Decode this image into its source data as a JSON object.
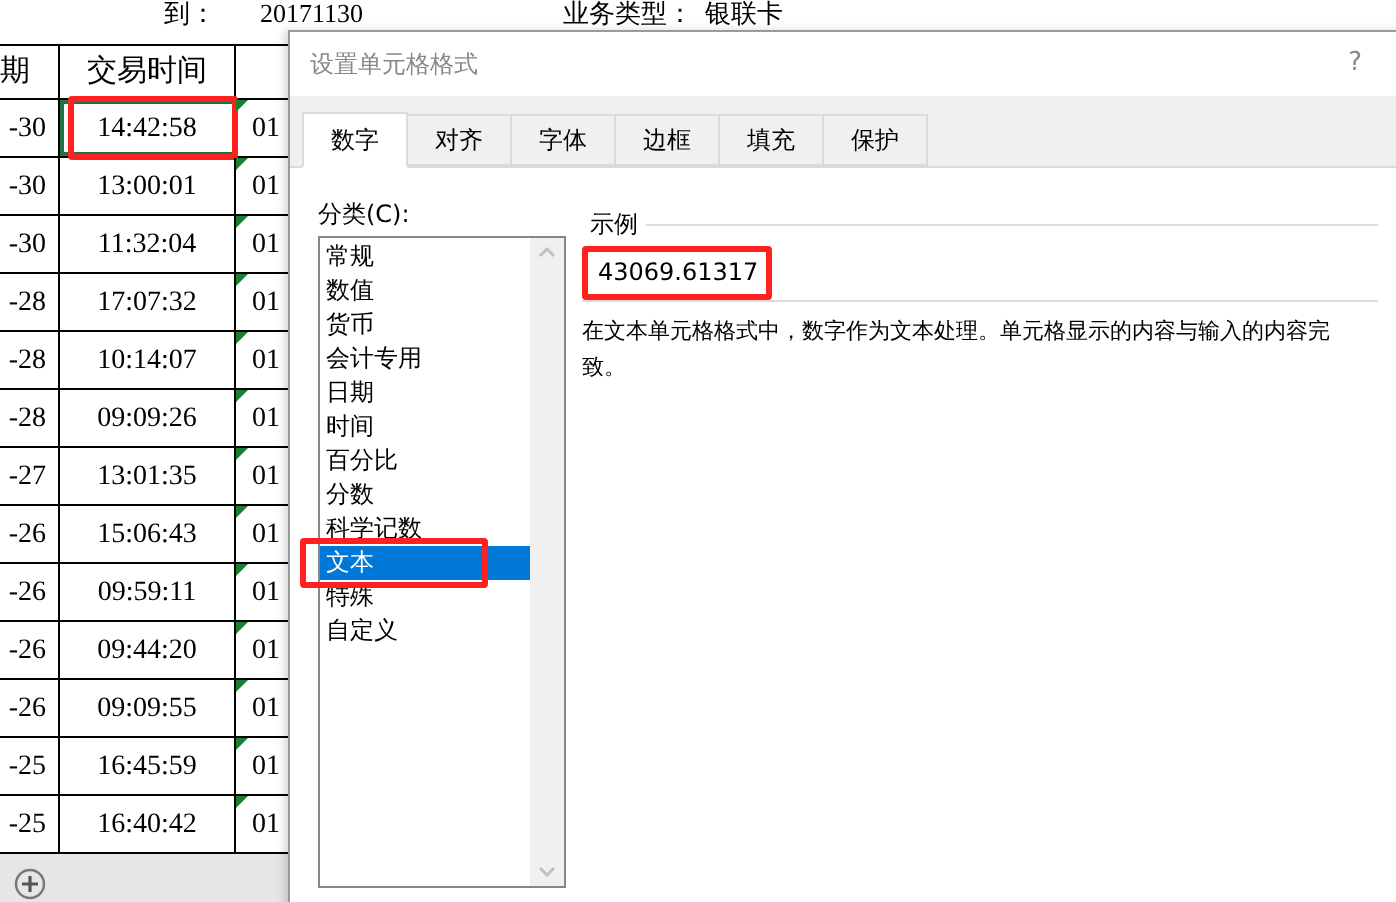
{
  "report_header": {
    "to_label": "到：",
    "to_value": "20171130",
    "type_label": "业务类型：",
    "type_value": "银联卡"
  },
  "table": {
    "columns": [
      "期",
      "交易时间"
    ],
    "rows": [
      {
        "cells": [
          "-30",
          "14:42:58",
          "01"
        ],
        "selected": true,
        "highlighted": true
      },
      {
        "cells": [
          "-30",
          "13:00:01",
          "01"
        ],
        "selected": false,
        "highlighted": false
      },
      {
        "cells": [
          "-30",
          "11:32:04",
          "01"
        ],
        "selected": false,
        "highlighted": false
      },
      {
        "cells": [
          "-28",
          "17:07:32",
          "01"
        ],
        "selected": false,
        "highlighted": false
      },
      {
        "cells": [
          "-28",
          "10:14:07",
          "01"
        ],
        "selected": false,
        "highlighted": false
      },
      {
        "cells": [
          "-28",
          "09:09:26",
          "01"
        ],
        "selected": false,
        "highlighted": false
      },
      {
        "cells": [
          "-27",
          "13:01:35",
          "01"
        ],
        "selected": false,
        "highlighted": false
      },
      {
        "cells": [
          "-26",
          "15:06:43",
          "01"
        ],
        "selected": false,
        "highlighted": false
      },
      {
        "cells": [
          "-26",
          "09:59:11",
          "01"
        ],
        "selected": false,
        "highlighted": false
      },
      {
        "cells": [
          "-26",
          "09:44:20",
          "01"
        ],
        "selected": false,
        "highlighted": false
      },
      {
        "cells": [
          "-26",
          "09:09:55",
          "01"
        ],
        "selected": false,
        "highlighted": false
      },
      {
        "cells": [
          "-25",
          "16:45:59",
          "01"
        ],
        "selected": false,
        "highlighted": false
      },
      {
        "cells": [
          "-25",
          "16:40:42",
          "01"
        ],
        "selected": false,
        "highlighted": false
      }
    ]
  },
  "dialog": {
    "title": "设置单元格格式",
    "help": "?",
    "tabs": [
      {
        "label": "数字",
        "selected": true
      },
      {
        "label": "对齐",
        "selected": false
      },
      {
        "label": "字体",
        "selected": false
      },
      {
        "label": "边框",
        "selected": false
      },
      {
        "label": "填充",
        "selected": false
      },
      {
        "label": "保护",
        "selected": false
      }
    ],
    "category_label": "分类(C):",
    "categories": [
      {
        "label": "常规",
        "selected": false,
        "highlighted": false
      },
      {
        "label": "数值",
        "selected": false,
        "highlighted": false
      },
      {
        "label": "货币",
        "selected": false,
        "highlighted": false
      },
      {
        "label": "会计专用",
        "selected": false,
        "highlighted": false
      },
      {
        "label": "日期",
        "selected": false,
        "highlighted": false
      },
      {
        "label": "时间",
        "selected": false,
        "highlighted": false
      },
      {
        "label": "百分比",
        "selected": false,
        "highlighted": false
      },
      {
        "label": "分数",
        "selected": false,
        "highlighted": false
      },
      {
        "label": "科学记数",
        "selected": false,
        "highlighted": false
      },
      {
        "label": "文本",
        "selected": true,
        "highlighted": true
      },
      {
        "label": "特殊",
        "selected": false,
        "highlighted": false
      },
      {
        "label": "自定义",
        "selected": false,
        "highlighted": false
      }
    ],
    "sample": {
      "title": "示例",
      "value": "43069.61317",
      "highlighted": true
    },
    "description": [
      "在文本单元格格式中，数字作为文本处理。单元格显示的内容与输入的内容完",
      "致。"
    ]
  }
}
